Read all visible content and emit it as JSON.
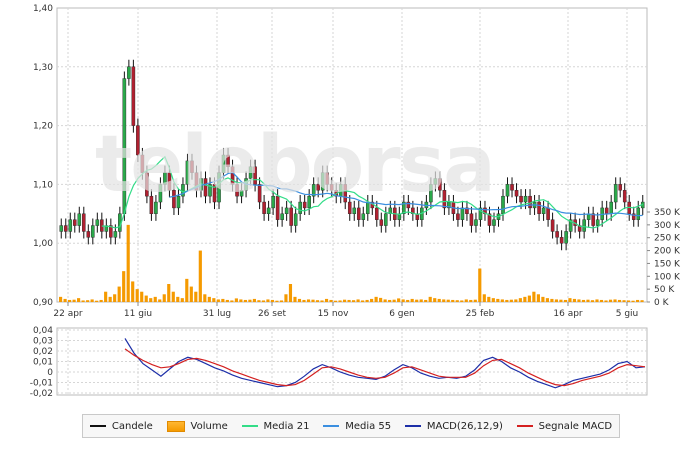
{
  "chart_data": [
    {
      "type": "candlestick",
      "panel": "price",
      "y_ticks": [
        "1,40",
        "1,30",
        "1,20",
        "1,10",
        "1,00",
        "0,90"
      ],
      "ylim": [
        0.9,
        1.4
      ],
      "x_ticks": [
        "22 apr",
        "11 giu",
        "31 lug",
        "26 set",
        "15 nov",
        "6 gen",
        "25 feb",
        "16 apr",
        "5 giu"
      ],
      "volume_ticks": [
        "350 K",
        "300 K",
        "250 K",
        "200 K",
        "150 K",
        "100 K",
        "50 K",
        "0 K"
      ],
      "volume_lim": [
        0,
        350000
      ],
      "series_close": [
        1.03,
        1.02,
        1.04,
        1.03,
        1.05,
        1.02,
        1.01,
        1.03,
        1.04,
        1.02,
        1.03,
        1.01,
        1.02,
        1.05,
        1.28,
        1.3,
        1.2,
        1.15,
        1.12,
        1.08,
        1.05,
        1.07,
        1.1,
        1.12,
        1.09,
        1.06,
        1.08,
        1.1,
        1.14,
        1.12,
        1.09,
        1.11,
        1.08,
        1.1,
        1.07,
        1.12,
        1.15,
        1.13,
        1.1,
        1.08,
        1.09,
        1.11,
        1.13,
        1.1,
        1.07,
        1.05,
        1.06,
        1.08,
        1.04,
        1.05,
        1.06,
        1.03,
        1.05,
        1.07,
        1.06,
        1.08,
        1.1,
        1.09,
        1.12,
        1.1,
        1.09,
        1.08,
        1.1,
        1.07,
        1.05,
        1.06,
        1.04,
        1.05,
        1.07,
        1.06,
        1.04,
        1.03,
        1.05,
        1.06,
        1.04,
        1.05,
        1.07,
        1.06,
        1.05,
        1.04,
        1.06,
        1.07,
        1.1,
        1.11,
        1.09,
        1.06,
        1.07,
        1.05,
        1.04,
        1.06,
        1.05,
        1.03,
        1.04,
        1.06,
        1.05,
        1.03,
        1.04,
        1.05,
        1.08,
        1.1,
        1.09,
        1.08,
        1.07,
        1.08,
        1.06,
        1.07,
        1.05,
        1.06,
        1.04,
        1.02,
        1.01,
        1.0,
        1.02,
        1.04,
        1.03,
        1.02,
        1.04,
        1.05,
        1.03,
        1.04,
        1.06,
        1.05,
        1.07,
        1.1,
        1.09,
        1.07,
        1.05,
        1.04,
        1.06,
        1.07
      ],
      "volume": [
        20000,
        12000,
        8000,
        9000,
        15000,
        6000,
        7000,
        10000,
        5000,
        8000,
        40000,
        20000,
        30000,
        60000,
        120000,
        300000,
        80000,
        50000,
        40000,
        25000,
        15000,
        20000,
        10000,
        30000,
        70000,
        40000,
        20000,
        15000,
        90000,
        60000,
        40000,
        200000,
        30000,
        20000,
        15000,
        10000,
        12000,
        8000,
        6000,
        14000,
        10000,
        8000,
        9000,
        12000,
        7000,
        6000,
        10000,
        8000,
        5000,
        6000,
        30000,
        70000,
        20000,
        12000,
        8000,
        10000,
        9000,
        7000,
        6000,
        12000,
        8000,
        5000,
        6000,
        9000,
        8000,
        7000,
        10000,
        6000,
        8000,
        12000,
        20000,
        16000,
        10000,
        8000,
        9000,
        14000,
        10000,
        8000,
        12000,
        9000,
        10000,
        8000,
        20000,
        15000,
        12000,
        10000,
        9000,
        8000,
        7000,
        6000,
        10000,
        8000,
        9000,
        130000,
        30000,
        20000,
        15000,
        12000,
        10000,
        8000,
        9000,
        10000,
        15000,
        20000,
        25000,
        40000,
        30000,
        20000,
        15000,
        12000,
        10000,
        9000,
        8000,
        15000,
        12000,
        10000,
        8000,
        9000,
        7000,
        10000,
        8000,
        6000,
        9000,
        10000,
        8000,
        7000,
        6000,
        5000,
        8000,
        7000
      ]
    },
    {
      "type": "line",
      "panel": "macd",
      "y_ticks": [
        "0,04",
        "0,03",
        "0,02",
        "0,01",
        "0",
        "-0,01",
        "-0,02"
      ],
      "ylim": [
        -0.02,
        0.04
      ],
      "series": [
        {
          "name": "MACD(26,12,9)",
          "values": [
            0.032,
            0.018,
            0.008,
            0.002,
            -0.004,
            0.003,
            0.01,
            0.014,
            0.012,
            0.008,
            0.004,
            0.001,
            -0.003,
            -0.006,
            -0.008,
            -0.01,
            -0.012,
            -0.014,
            -0.013,
            -0.01,
            -0.004,
            0.003,
            0.007,
            0.004,
            0.0,
            -0.003,
            -0.005,
            -0.006,
            -0.007,
            -0.004,
            0.002,
            0.007,
            0.004,
            -0.001,
            -0.004,
            -0.006,
            -0.005,
            -0.006,
            -0.004,
            0.002,
            0.011,
            0.014,
            0.01,
            0.004,
            0.0,
            -0.005,
            -0.009,
            -0.012,
            -0.015,
            -0.012,
            -0.008,
            -0.006,
            -0.004,
            -0.002,
            0.002,
            0.008,
            0.01,
            0.004,
            0.005
          ]
        },
        {
          "name": "Segnale MACD",
          "values": [
            0.022,
            0.016,
            0.011,
            0.007,
            0.004,
            0.005,
            0.008,
            0.012,
            0.013,
            0.011,
            0.008,
            0.005,
            0.001,
            -0.002,
            -0.005,
            -0.008,
            -0.01,
            -0.012,
            -0.013,
            -0.012,
            -0.008,
            -0.002,
            0.004,
            0.005,
            0.003,
            0.0,
            -0.003,
            -0.005,
            -0.006,
            -0.005,
            -0.001,
            0.004,
            0.005,
            0.002,
            -0.001,
            -0.004,
            -0.005,
            -0.005,
            -0.005,
            -0.001,
            0.006,
            0.011,
            0.012,
            0.008,
            0.004,
            -0.001,
            -0.005,
            -0.009,
            -0.012,
            -0.013,
            -0.011,
            -0.008,
            -0.006,
            -0.004,
            -0.001,
            0.004,
            0.007,
            0.006,
            0.005
          ]
        }
      ]
    }
  ],
  "legend": [
    {
      "label": "Candele",
      "color": "#111111",
      "kind": "line"
    },
    {
      "label": "Volume",
      "color": "#f59a00",
      "kind": "bar"
    },
    {
      "label": "Media 21",
      "color": "#33dd88",
      "kind": "line"
    },
    {
      "label": "Media 55",
      "color": "#3b8fe0",
      "kind": "line"
    },
    {
      "label": "MACD(26,12,9)",
      "color": "#1d2fa8",
      "kind": "line"
    },
    {
      "label": "Segnale MACD",
      "color": "#d42020",
      "kind": "line"
    }
  ],
  "watermark": "teleborsa",
  "colors": {
    "up": "#2aa84a",
    "down": "#b02030",
    "grid": "#d6d6d6",
    "volume": "#f59a00"
  }
}
